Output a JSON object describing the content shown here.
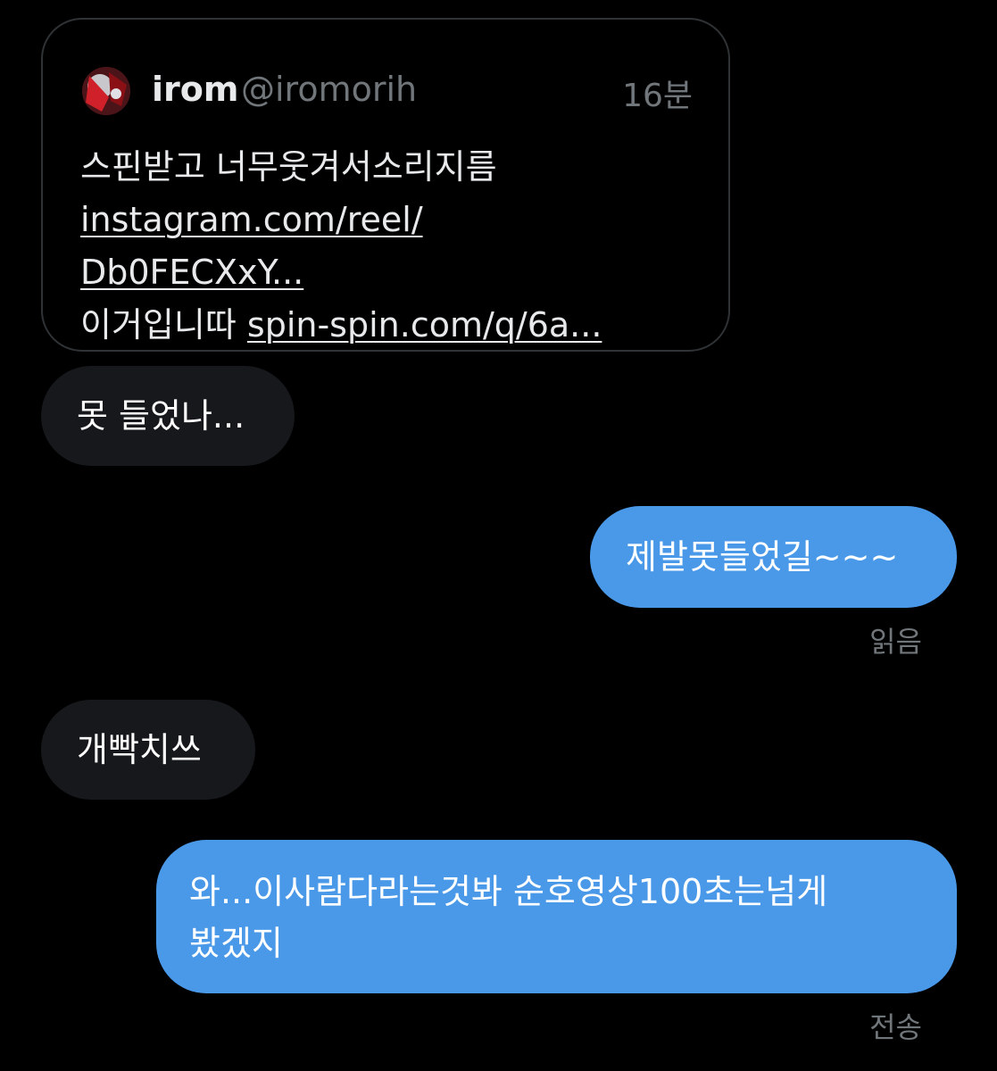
{
  "quote": {
    "author_name": "irom",
    "author_handle": "@iromorih",
    "time_ago": "16분",
    "avatar_icon": "profile-avatar",
    "lines": {
      "text": "스핀받고 너무웃겨서소리지름",
      "link_1a": "instagram.com/reel/",
      "link_1b": "Db0FECXxY...",
      "prefix": "이거입니따",
      "link_2": "spin-spin.com/q/6a..."
    }
  },
  "messages": {
    "msg1": "못 들었나...",
    "msg2": "제발못들었길~~~",
    "msg2_status": "읽음",
    "msg3": "개빡치쓰",
    "msg4_line1": "와...이사람다라는것봐 순호영상100초는넘게",
    "msg4_line2": "봤겠지",
    "msg4_status": "전송"
  },
  "colors": {
    "background": "#000000",
    "incoming_bubble": "#16181c",
    "outgoing_bubble": "#4a99e9",
    "muted_text": "#71767b"
  }
}
